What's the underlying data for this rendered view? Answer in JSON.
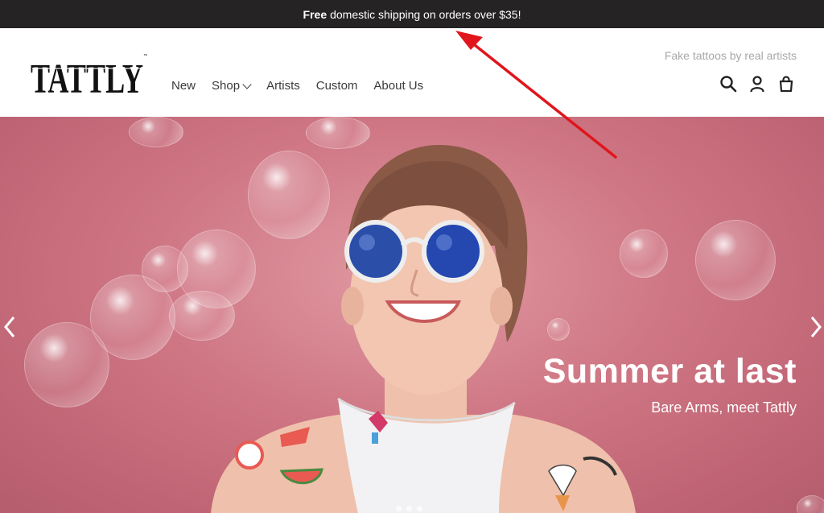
{
  "announcement": {
    "bold": "Free",
    "text": "domestic shipping on orders over $35!"
  },
  "header": {
    "logo": "TATTLY",
    "tagline": "Fake tattoos by real artists",
    "nav": [
      {
        "label": "New"
      },
      {
        "label": "Shop"
      },
      {
        "label": "Artists"
      },
      {
        "label": "Custom"
      },
      {
        "label": "About Us"
      }
    ],
    "icons": [
      "search-icon",
      "account-icon",
      "cart-icon"
    ]
  },
  "hero": {
    "title": "Summer at last",
    "subtitle": "Bare Arms, meet Tattly",
    "slide_count": 3,
    "colors": {
      "background": "#cf7684",
      "announcement_bar": "#262324",
      "annotation_arrow": "#e0161c"
    }
  }
}
